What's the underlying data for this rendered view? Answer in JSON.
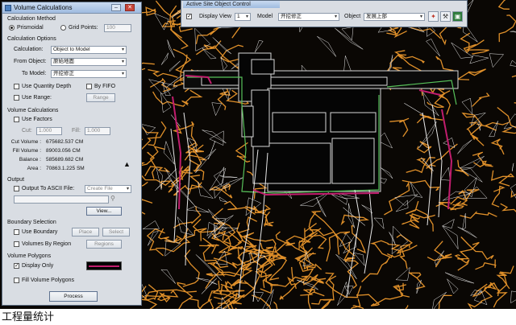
{
  "caption": "工程量统计",
  "dialog": {
    "title": "Volume Calculations",
    "calculation_method": {
      "heading": "Calculation Method",
      "options": [
        "Prismoidal",
        "Grid Points:"
      ],
      "selected": "Prismoidal",
      "grid_points_value": "100"
    },
    "calculation_options": {
      "heading": "Calculation Options",
      "calculation_label": "Calculation:",
      "calculation_value": "Object to Model",
      "from_object_label": "From Object:",
      "from_object_value": "原始地面",
      "to_model_label": "To Model:",
      "to_model_value": "开挖修正",
      "use_quantity_depth": "Use Quantity Depth",
      "by_fifo": "By FIFO",
      "use_range": "Use Range:",
      "range_button": "Range"
    },
    "volume_calculations": {
      "heading": "Volume Calculations",
      "use_factors": "Use Factors",
      "cut_label": "Cut:",
      "cut_value": "1.000",
      "fill_label": "Fill:",
      "fill_value": "1.000",
      "results": [
        {
          "label": "Cut Volume :",
          "value": "675682.537 CM"
        },
        {
          "label": "Fill Volume :",
          "value": "89003.056 CM"
        },
        {
          "label": "Balance :",
          "value": "585689.682 CM"
        },
        {
          "label": "Area :",
          "value": "70863.1.225 SM"
        }
      ]
    },
    "output": {
      "heading": "Output",
      "output_to_ascii": "Output To ASCII File:",
      "create_file_option": "Create File",
      "view_button": "View..."
    },
    "boundary_selection": {
      "heading": "Boundary Selection",
      "use_boundary": "Use Boundary",
      "place_button": "Place",
      "select_button": "Select",
      "volumes_by_region": "Volumes By Region",
      "regions_button": "Regions"
    },
    "volume_polygons": {
      "heading": "Volume Polygons",
      "display_only": "Display Only",
      "display_only_checked": true,
      "swatch_color": "#c21d6e",
      "fill_volume_polygons": "Fill Volume Polygons"
    },
    "process_button": "Process"
  },
  "toolbar": {
    "title": "Active Site Object Control",
    "display_view_label": "Display View",
    "display_view_value": "1",
    "model_label": "Model",
    "model_value": "开挖修正",
    "object_label": "Object",
    "object_value": "发展上部",
    "icons": [
      "pick-object-icon",
      "tool-icon",
      "paint-icon"
    ]
  },
  "colors": {
    "terrain_orange": "#e0902a",
    "contour_white": "#e8e8e8",
    "boundary_magenta": "#c21d6e",
    "road_green": "#58c25a"
  }
}
